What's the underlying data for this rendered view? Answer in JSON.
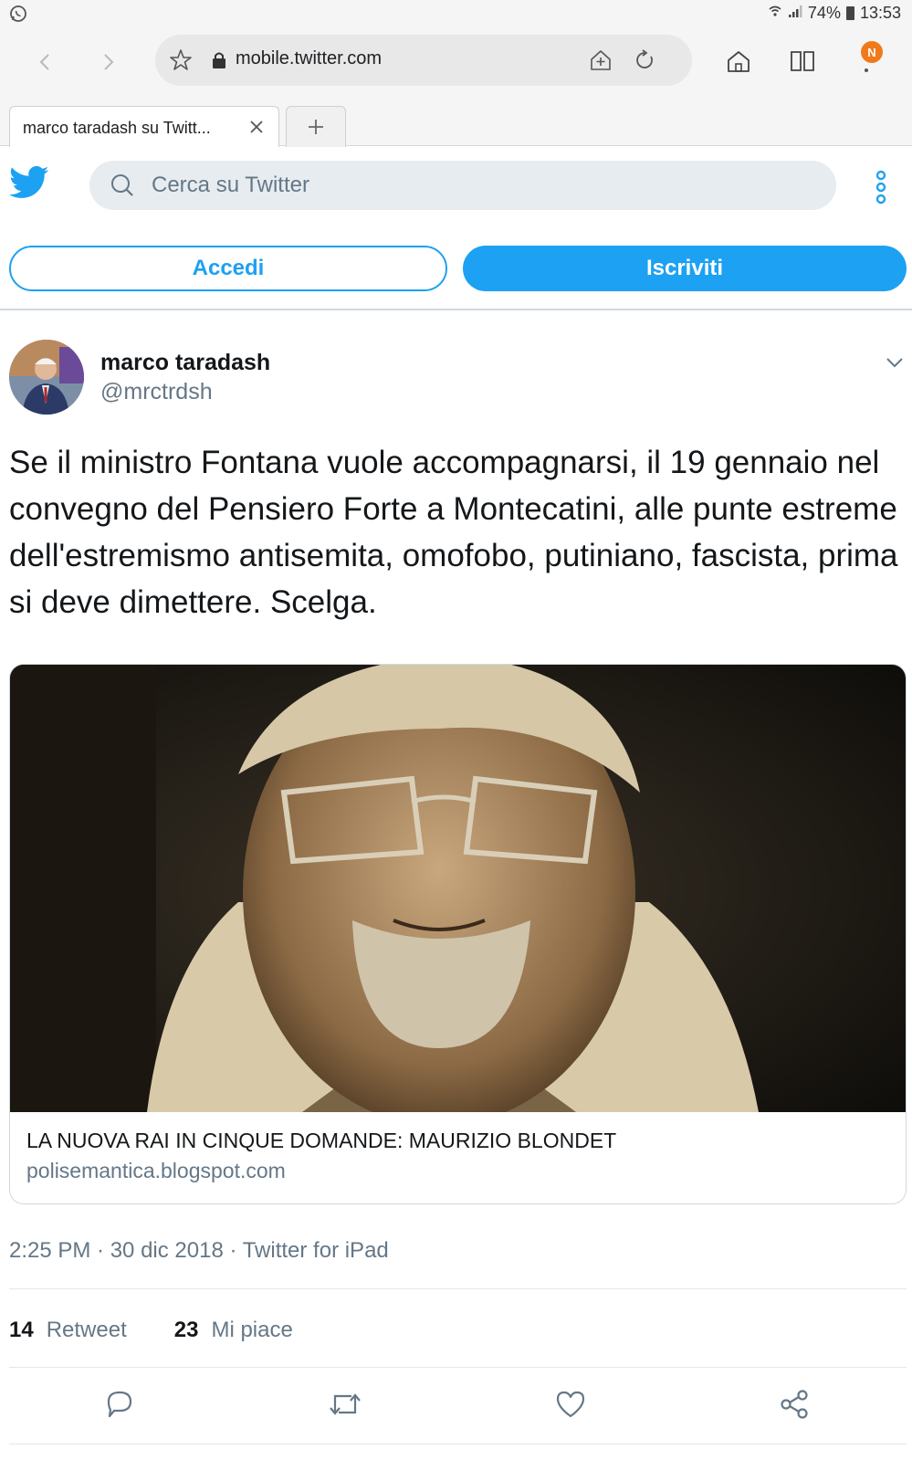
{
  "status_bar": {
    "battery": "74%",
    "time": "13:53"
  },
  "browser": {
    "url": "mobile.twitter.com"
  },
  "tabs": [
    {
      "title": "marco taradash su Twitt..."
    }
  ],
  "twitter_header": {
    "search_placeholder": "Cerca su Twitter",
    "login_label": "Accedi",
    "signup_label": "Iscriviti"
  },
  "tweet": {
    "author_name": "marco taradash",
    "author_handle": "@mrctrdsh",
    "text": "Se il ministro Fontana vuole accompagnarsi, il 19 gennaio nel convegno del Pensiero Forte a Montecatini, alle punte estreme dell'estremismo antisemita, omofobo, putiniano, fascista, prima si deve dimettere. Scelga.",
    "card": {
      "title": "LA NUOVA RAI IN CINQUE DOMANDE: MAURIZIO BLONDET",
      "domain": "polisemantica.blogspot.com"
    },
    "meta": "2:25 PM · 30 dic 2018 · Twitter for iPad",
    "retweet_count": "14",
    "retweet_label": "Retweet",
    "like_count": "23",
    "like_label": "Mi piace"
  },
  "colors": {
    "twitter_blue": "#1da1f2",
    "secondary_text": "#657786",
    "notification": "#f07a1a"
  }
}
